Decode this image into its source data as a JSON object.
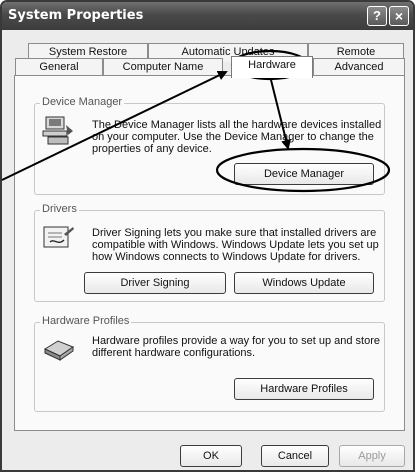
{
  "window": {
    "title": "System Properties",
    "help_icon": "?",
    "close_icon": "×"
  },
  "tabs": {
    "row1": [
      "System Restore",
      "Automatic Updates",
      "Remote"
    ],
    "row2": [
      "General",
      "Computer Name",
      "Hardware",
      "Advanced"
    ],
    "active": "Hardware"
  },
  "device_manager": {
    "group_label": "Device Manager",
    "description": [
      "The Device Manager lists all the hardware devices installed",
      "on your computer. Use the Device Manager to change the",
      "properties of any device."
    ],
    "button": "Device Manager",
    "icon": "device-manager-icon"
  },
  "drivers": {
    "group_label": "Drivers",
    "description": [
      "Driver Signing lets you make sure that installed drivers are",
      "compatible with Windows. Windows Update lets you set up",
      "how Windows connects to Windows Update for drivers."
    ],
    "signing_button": "Driver Signing",
    "update_button": "Windows Update",
    "icon": "driver-signing-icon"
  },
  "hardware_profiles": {
    "group_label": "Hardware Profiles",
    "description": [
      "Hardware profiles provide a way for you to set up and store",
      "different hardware configurations."
    ],
    "button": "Hardware Profiles",
    "icon": "hardware-profiles-icon"
  },
  "footer": {
    "ok": "OK",
    "cancel": "Cancel",
    "apply": "Apply"
  },
  "colors": {
    "titlebar": "#4a4a4a",
    "annotation": "#000000"
  }
}
